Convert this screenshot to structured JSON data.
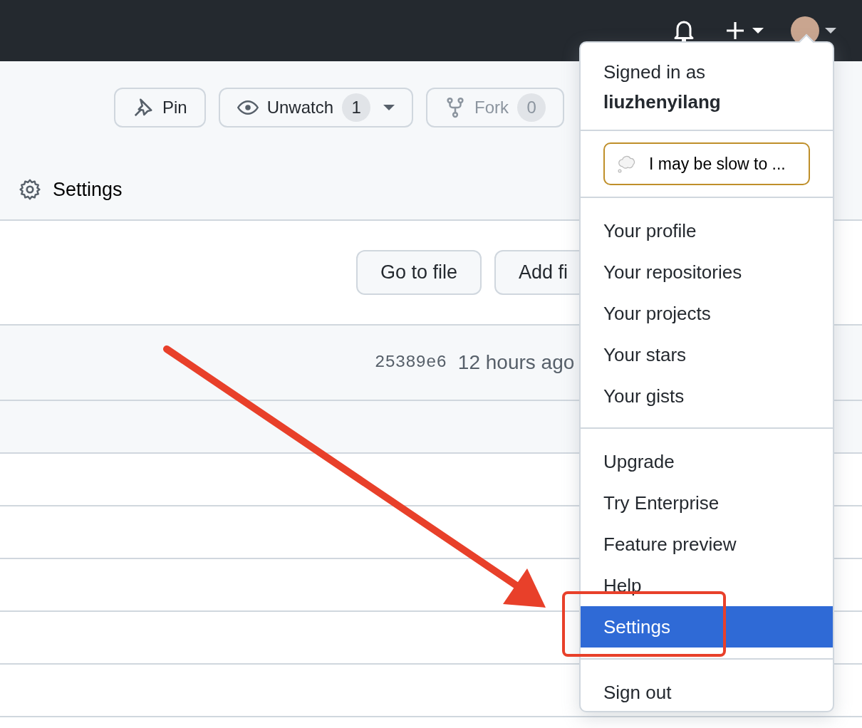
{
  "header": {
    "menus": [
      {
        "kind": "notifications"
      },
      {
        "kind": "create",
        "caret": true
      },
      {
        "kind": "avatar",
        "caret": true
      }
    ]
  },
  "repo_actions": [
    {
      "kind": "pin",
      "label": "Pin",
      "disabled": false
    },
    {
      "kind": "watch",
      "label": "Unwatch",
      "count": "1",
      "caret": true,
      "disabled": false
    },
    {
      "kind": "fork",
      "label": "Fork",
      "count": "0",
      "disabled": true
    }
  ],
  "repo_tab": {
    "label": "Settings"
  },
  "file_buttons": [
    "Go to file",
    "Add fi"
  ],
  "commit": {
    "sha": "25389e6",
    "time": "12 hours ago"
  },
  "user_menu": {
    "signed_in_label": "Signed in as",
    "username": "liuzhenyilang",
    "status": "I may be slow to ...",
    "groups": [
      [
        {
          "label": "Your profile",
          "selected": false
        },
        {
          "label": "Your repositories",
          "selected": false
        },
        {
          "label": "Your projects",
          "selected": false
        },
        {
          "label": "Your stars",
          "selected": false
        },
        {
          "label": "Your gists",
          "selected": false
        }
      ],
      [
        {
          "label": "Upgrade",
          "selected": false
        },
        {
          "label": "Try Enterprise",
          "selected": false
        },
        {
          "label": "Feature preview",
          "selected": false
        },
        {
          "label": "Help",
          "selected": false
        },
        {
          "label": "Settings",
          "selected": true
        }
      ],
      [
        {
          "label": "Sign out",
          "selected": false
        }
      ]
    ]
  }
}
